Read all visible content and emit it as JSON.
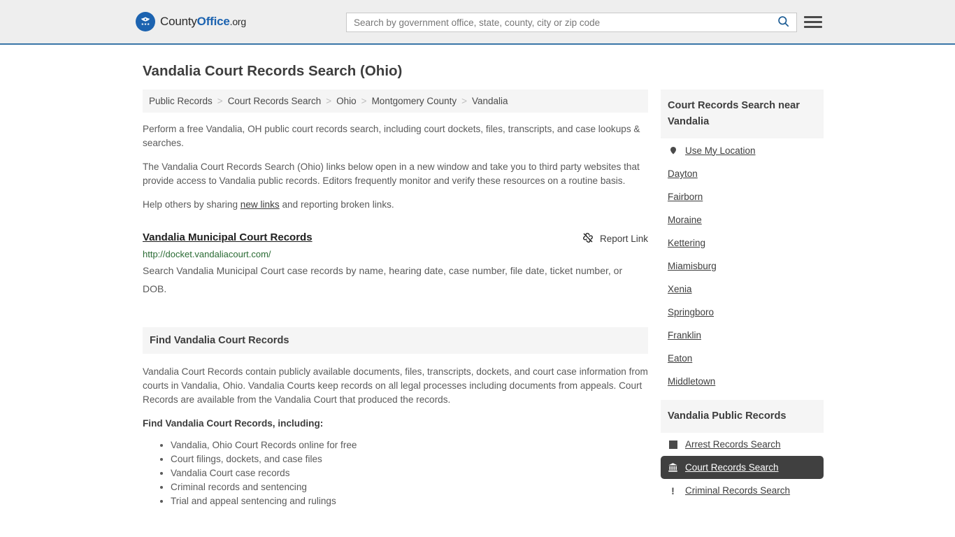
{
  "header": {
    "logo": {
      "part1": "County",
      "part2": "Office",
      "part3": ".org",
      "icon": "eagle-seal-icon"
    },
    "search": {
      "placeholder": "Search by government office, state, county, city or zip code",
      "value": "",
      "button_icon": "search-icon"
    },
    "menu_icon": "hamburger-menu-icon",
    "accent_color": "#3a76a8"
  },
  "page": {
    "title": "Vandalia Court Records Search (Ohio)"
  },
  "breadcrumb": {
    "separator": ">",
    "items": [
      {
        "label": "Public Records"
      },
      {
        "label": "Court Records Search"
      },
      {
        "label": "Ohio"
      },
      {
        "label": "Montgomery County"
      },
      {
        "label": "Vandalia"
      }
    ]
  },
  "intro": {
    "paragraph1": "Perform a free Vandalia, OH public court records search, including court dockets, files, transcripts, and case lookups & searches.",
    "paragraph2": "The Vandalia Court Records Search (Ohio) links below open in a new window and take you to third party websites that provide access to Vandalia public records. Editors frequently monitor and verify these resources on a routine basis.",
    "paragraph3_prefix": "Help others by sharing ",
    "paragraph3_link": "new links",
    "paragraph3_suffix": " and reporting broken links."
  },
  "entry": {
    "title": "Vandalia Municipal Court Records",
    "url": "http://docket.vandaliacourt.com/",
    "description": "Search Vandalia Municipal Court case records by name, hearing date, case number, file date, ticket number, or DOB.",
    "report_label": "Report Link",
    "report_icon": "broken-link-icon"
  },
  "find_section": {
    "heading": "Find Vandalia Court Records",
    "body": "Vandalia Court Records contain publicly available documents, files, transcripts, dockets, and court case information from courts in Vandalia, Ohio. Vandalia Courts keep records on all legal processes including documents from appeals. Court Records are available from the Vandalia Court that produced the records.",
    "sub_heading": "Find Vandalia Court Records, including:",
    "bullets": [
      "Vandalia, Ohio Court Records online for free",
      "Court filings, dockets, and case files",
      "Vandalia Court case records",
      "Criminal records and sentencing",
      "Trial and appeal sentencing and rulings"
    ]
  },
  "sidebar": {
    "nearby": {
      "heading": "Court Records Search near Vandalia",
      "items": [
        {
          "label": "Use My Location",
          "icon": "map-pin-icon"
        },
        {
          "label": "Dayton",
          "icon": ""
        },
        {
          "label": "Fairborn",
          "icon": ""
        },
        {
          "label": "Moraine",
          "icon": ""
        },
        {
          "label": "Kettering",
          "icon": ""
        },
        {
          "label": "Miamisburg",
          "icon": ""
        },
        {
          "label": "Xenia",
          "icon": ""
        },
        {
          "label": "Springboro",
          "icon": ""
        },
        {
          "label": "Franklin",
          "icon": ""
        },
        {
          "label": "Eaton",
          "icon": ""
        },
        {
          "label": "Middletown",
          "icon": ""
        }
      ]
    },
    "public_records": {
      "heading": "Vandalia Public Records",
      "active_color": "#404040",
      "items": [
        {
          "label": "Arrest Records Search",
          "icon": "square-icon",
          "active": false
        },
        {
          "label": "Court Records Search",
          "icon": "courthouse-icon",
          "active": true
        },
        {
          "label": "Criminal Records Search",
          "icon": "exclamation-icon",
          "active": false
        }
      ]
    }
  }
}
